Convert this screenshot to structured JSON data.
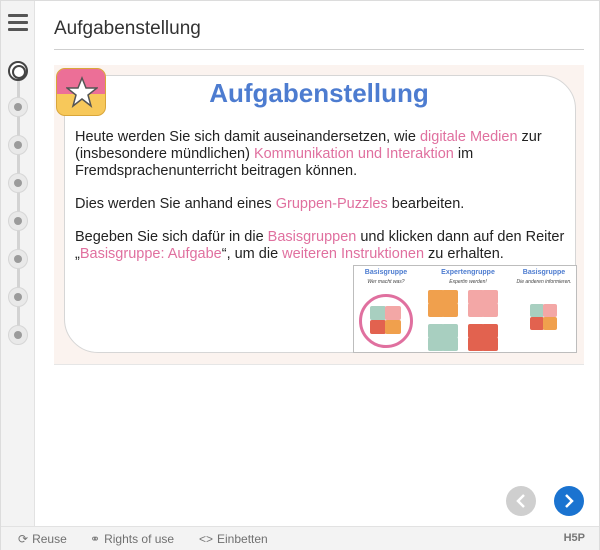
{
  "header": {
    "title": "Aufgabenstellung"
  },
  "nav": {
    "menu_icon": "hamburger-icon",
    "steps": 8,
    "active_step": 1
  },
  "slide": {
    "heading": "Aufgabenstellung",
    "badge_icon": "star-icon",
    "p1": {
      "t1": "Heute werden Sie sich damit auseinandersetzen, wie ",
      "h1": "digitale Medien",
      "t2": " zur (insbesondere mündlichen) ",
      "h2": "Kommunikation und Interaktion",
      "t3": " im Fremdsprachenunterricht beitragen können."
    },
    "p2": {
      "t1": "Dies werden Sie anhand eines ",
      "h1": "Gruppen-Puzzles",
      "t2": " bearbeiten."
    },
    "p3": {
      "t1": "Begeben Sie sich dafür in die ",
      "h1": "Basisgruppen",
      "t2": " und klicken dann auf den Reiter „",
      "h2": "Basisgruppe: Aufgabe",
      "t3": "“, um die ",
      "h3": "weiteren Instruktionen",
      "t4": " zu erhalten."
    },
    "thumbnail": {
      "col1_title": "Basisgruppe",
      "col1_sub": "Wer macht was?",
      "col2_title": "Expertengruppe",
      "col2_sub": "Expertin werden!",
      "col3_title": "Basisgruppe",
      "col3_sub": "Die anderen informieren."
    }
  },
  "controls": {
    "prev_icon": "chevron-left-icon",
    "next_icon": "chevron-right-icon"
  },
  "footer": {
    "reuse_label": "Reuse",
    "reuse_icon": "refresh-icon",
    "rights_label": "Rights of use",
    "rights_icon": "handshake-icon",
    "embed_label": "Einbetten",
    "embed_icon": "code-icon",
    "brand": "H5P"
  },
  "colors": {
    "accent_blue": "#4d7cd0",
    "highlight_pink": "#e0709f",
    "next_button": "#1a73d0",
    "slide_bg": "#fbf3ef"
  }
}
